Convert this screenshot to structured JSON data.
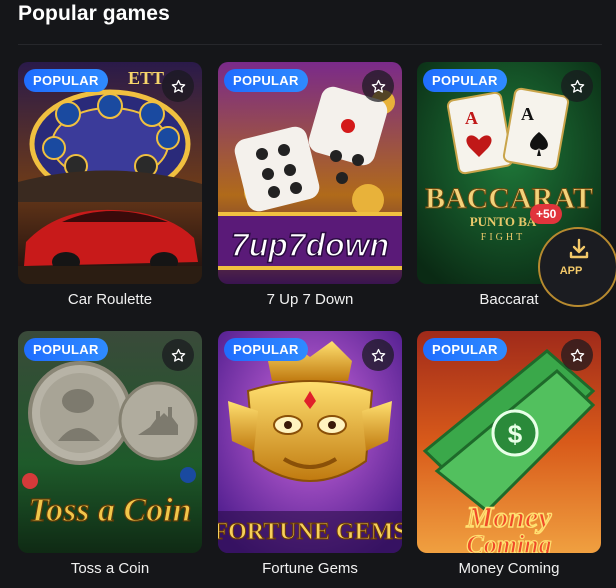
{
  "section": {
    "title": "Popular games"
  },
  "badge_label": "POPULAR",
  "games": [
    {
      "name": "Car Roulette",
      "art_text": "ETT"
    },
    {
      "name": "7 Up 7 Down",
      "art_text": "7up7down"
    },
    {
      "name": "Baccarat",
      "art_text": "BACCARAT",
      "art_subtext": "PUNTO BA",
      "art_subtext2": "FIGHT"
    },
    {
      "name": "Toss a Coin",
      "art_text": "Toss a Coin"
    },
    {
      "name": "Fortune Gems",
      "art_text": "FORTUNE GEMS"
    },
    {
      "name": "Money Coming",
      "art_text": "Money",
      "art_subtext": "Coming"
    }
  ],
  "app_promo": {
    "label": "APP",
    "bonus": "+50"
  },
  "colors": {
    "badge": "#2f8bff",
    "background": "#151619",
    "accent_gold": "#f3c969"
  }
}
